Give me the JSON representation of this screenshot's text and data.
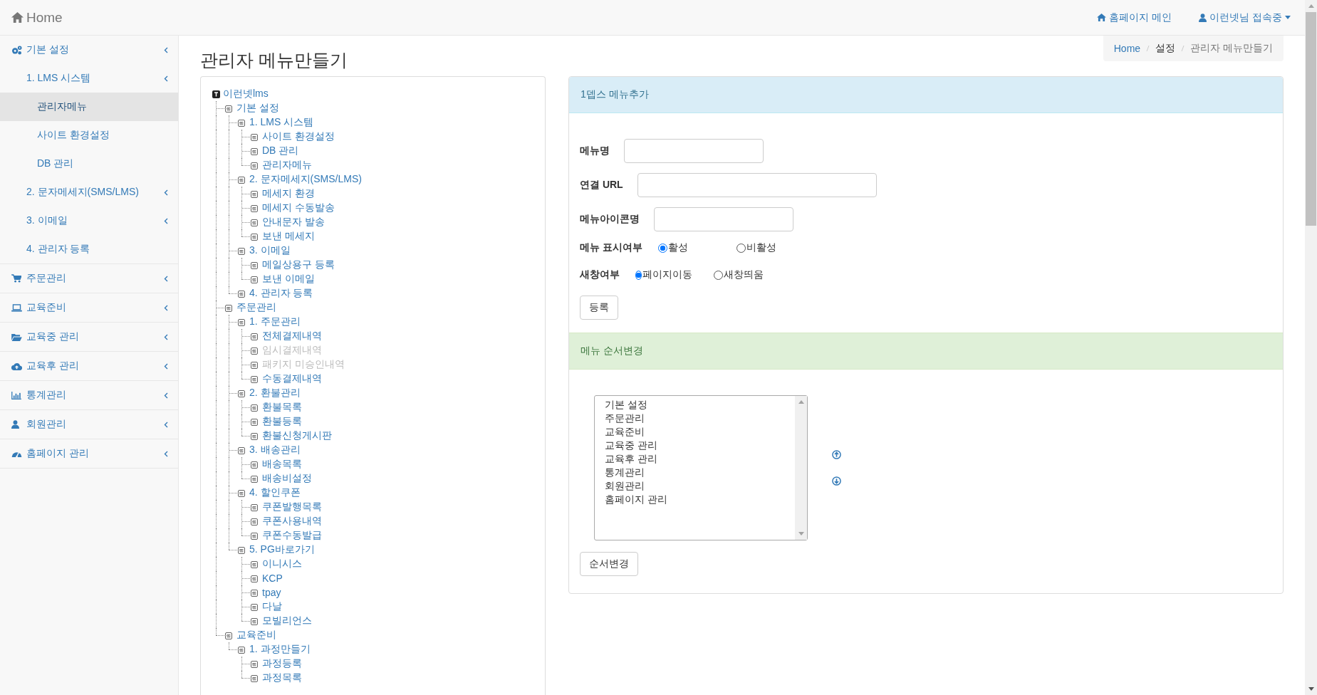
{
  "header": {
    "brand": "Home",
    "links": [
      {
        "kind": "home",
        "label": "홈페이지 메인"
      },
      {
        "kind": "user",
        "label": "이런넷님 접속중"
      }
    ]
  },
  "sidebar": {
    "items": [
      {
        "label": "기본 설정",
        "has_submenu": true,
        "selected": false,
        "children": [
          {
            "label": "1. LMS 시스템",
            "has_submenu": true,
            "selected": false,
            "children": [
              {
                "label": "관리자메뉴",
                "has_submenu": false,
                "selected": true
              },
              {
                "label": "사이트 환경설정",
                "has_submenu": false,
                "selected": false
              },
              {
                "label": "DB 관리",
                "has_submenu": false,
                "selected": false
              }
            ]
          },
          {
            "label": "2. 문자메세지(SMS/LMS)",
            "has_submenu": true,
            "selected": false
          },
          {
            "label": "3. 이메일",
            "has_submenu": true,
            "selected": false
          },
          {
            "label": "4. 관리자 등록",
            "has_submenu": false,
            "selected": false
          }
        ]
      },
      {
        "label": "주문관리",
        "has_submenu": true,
        "selected": false
      },
      {
        "label": "교육준비",
        "has_submenu": true,
        "selected": false
      },
      {
        "label": "교육중 관리",
        "has_submenu": true,
        "selected": false
      },
      {
        "label": "교육후 관리",
        "has_submenu": true,
        "selected": false
      },
      {
        "label": "통계관리",
        "has_submenu": true,
        "selected": false
      },
      {
        "label": "회원관리",
        "has_submenu": true,
        "selected": false
      },
      {
        "label": "홈페이지 관리",
        "has_submenu": true,
        "selected": false
      }
    ]
  },
  "page_title": "관리자 메뉴만들기",
  "breadcrumb": [
    {
      "kind": "link",
      "label": "Home"
    },
    {
      "kind": "text",
      "label": "설정"
    },
    {
      "kind": "active",
      "label": "관리자 메뉴만들기"
    }
  ],
  "tree": {
    "root": "이런넷lms",
    "children": [
      {
        "label": "기본 설정",
        "disabled": false,
        "children": [
          {
            "label": "1. LMS 시스템",
            "disabled": false,
            "children": [
              {
                "label": "사이트 환경설정",
                "disabled": false
              },
              {
                "label": "DB 관리",
                "disabled": false
              },
              {
                "label": "관리자메뉴",
                "disabled": false
              }
            ]
          },
          {
            "label": "2. 문자메세지(SMS/LMS)",
            "disabled": false,
            "children": [
              {
                "label": "메세지 환경",
                "disabled": false
              },
              {
                "label": "메세지 수동발송",
                "disabled": false
              },
              {
                "label": "안내문자 발송",
                "disabled": false
              },
              {
                "label": "보낸 메세지",
                "disabled": false
              }
            ]
          },
          {
            "label": "3. 이메일",
            "disabled": false,
            "children": [
              {
                "label": "메일상용구 등록",
                "disabled": false
              },
              {
                "label": "보낸 이메일",
                "disabled": false
              }
            ]
          },
          {
            "label": "4. 관리자 등록",
            "disabled": false
          }
        ]
      },
      {
        "label": "주문관리",
        "disabled": false,
        "children": [
          {
            "label": "1. 주문관리",
            "disabled": false,
            "children": [
              {
                "label": "전체결제내역",
                "disabled": false
              },
              {
                "label": "임시결제내역",
                "disabled": true
              },
              {
                "label": "패키지 미승인내역",
                "disabled": true
              },
              {
                "label": "수동결제내역",
                "disabled": false
              }
            ]
          },
          {
            "label": "2. 환불관리",
            "disabled": false,
            "children": [
              {
                "label": "환불목록",
                "disabled": false
              },
              {
                "label": "환불등록",
                "disabled": false
              },
              {
                "label": "환불신청게시판",
                "disabled": false
              }
            ]
          },
          {
            "label": "3. 배송관리",
            "disabled": false,
            "children": [
              {
                "label": "배송목록",
                "disabled": false
              },
              {
                "label": "배송비설정",
                "disabled": false
              }
            ]
          },
          {
            "label": "4. 할인쿠폰",
            "disabled": false,
            "children": [
              {
                "label": "쿠폰발행목록",
                "disabled": false
              },
              {
                "label": "쿠폰사용내역",
                "disabled": false
              },
              {
                "label": "쿠폰수동발급",
                "disabled": false
              }
            ]
          },
          {
            "label": "5. PG바로가기",
            "disabled": false,
            "children": [
              {
                "label": "이니시스",
                "disabled": false
              },
              {
                "label": "KCP",
                "disabled": false
              },
              {
                "label": "tpay",
                "disabled": false
              },
              {
                "label": "다날",
                "disabled": false
              },
              {
                "label": "모빌리언스",
                "disabled": false
              }
            ]
          }
        ]
      },
      {
        "label": "교육준비",
        "disabled": false,
        "children": [
          {
            "label": "1. 과정만들기",
            "disabled": false,
            "children": [
              {
                "label": "과정등록",
                "disabled": false
              },
              {
                "label": "과정목록",
                "disabled": false
              }
            ]
          }
        ]
      }
    ]
  },
  "add_panel": {
    "title": "1뎁스 메뉴추가",
    "fields": [
      {
        "kind": "text",
        "label": "메뉴명"
      },
      {
        "kind": "url",
        "label": "연결 URL"
      },
      {
        "kind": "text",
        "label": "메뉴아이콘명"
      },
      {
        "kind": "radio",
        "label": "메뉴 표시여부",
        "options": [
          {
            "label": "활성",
            "selected": true
          },
          {
            "label": "비활성",
            "selected": false
          }
        ]
      },
      {
        "kind": "radio",
        "label": "새창여부",
        "options": [
          {
            "label": "페이지이동",
            "selected": true
          },
          {
            "label": "새창띄움",
            "selected": false
          }
        ]
      }
    ],
    "submit": "등록"
  },
  "order_panel": {
    "title": "메뉴 순서변경",
    "items": [
      {
        "label": "기본 설정",
        "selected": false
      },
      {
        "label": "주문관리",
        "selected": false
      },
      {
        "label": "교육준비",
        "selected": false
      },
      {
        "label": "교육중 관리",
        "selected": false
      },
      {
        "label": "교육후 관리",
        "selected": false
      },
      {
        "label": "통계관리",
        "selected": false
      },
      {
        "label": "회원관리",
        "selected": false
      },
      {
        "label": "홈페이지 관리",
        "selected": false
      }
    ],
    "submit": "순서변경"
  }
}
